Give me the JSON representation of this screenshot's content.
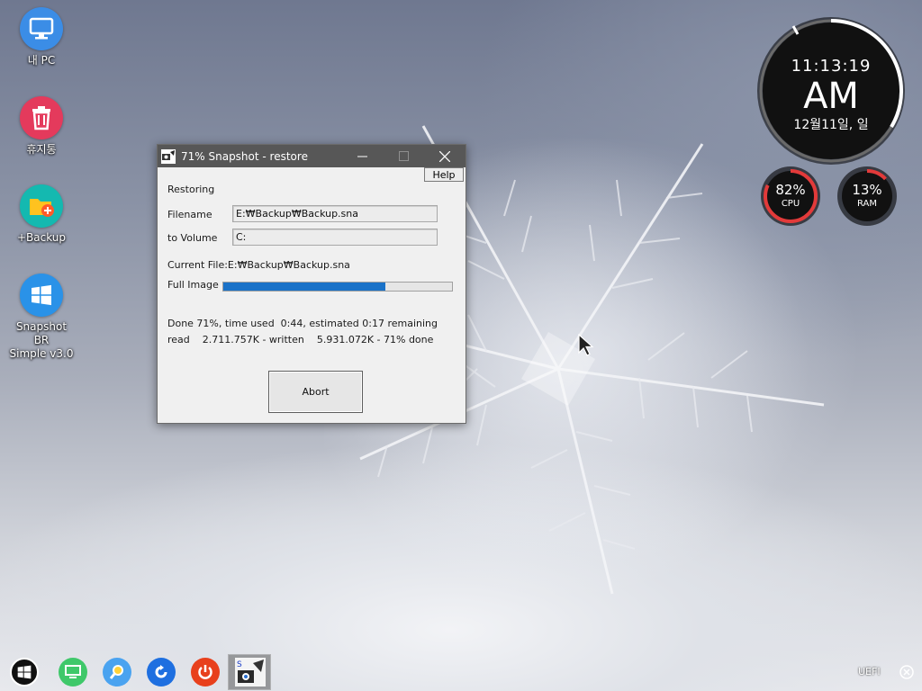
{
  "desktop": {
    "icons": [
      {
        "label": "내 PC",
        "icon": "monitor-icon",
        "color": "#3b8de6"
      },
      {
        "label": "휴지통",
        "icon": "trash-icon",
        "color": "#e43a5c"
      },
      {
        "label": "+Backup",
        "icon": "folder-plus-icon",
        "color": "#14b9b0"
      },
      {
        "label": "Snapshot BR\nSimple v3.0",
        "icon": "windows-logo-icon",
        "color": "#2a92e8"
      }
    ]
  },
  "clock": {
    "time": "11:13:19",
    "ampm": "AM",
    "date": "12월11일, 일"
  },
  "meters": {
    "cpu": {
      "value": "82%",
      "label": "CPU",
      "percent": 82,
      "color": "#e23a3a"
    },
    "ram": {
      "value": "13%",
      "label": "RAM",
      "percent": 13,
      "color": "#e23a3a"
    }
  },
  "dialog": {
    "title": "71% Snapshot - restore",
    "help_label": "Help",
    "status_label": "Restoring",
    "filename_label": "Filename",
    "filename_value": "E:₩Backup₩Backup.sna",
    "volume_label": "to Volume",
    "volume_value": "C:",
    "current_file": "Current File:E:₩Backup₩Backup.sna",
    "image_label": "Full Image",
    "progress_percent": 71,
    "line1": "Done 71%, time used  0:44, estimated 0:17 remaining",
    "line2": "read    2.711.757K - written    5.931.072K - 71% done",
    "abort_label": "Abort"
  },
  "taskbar": {
    "items": [
      "start-icon",
      "monitor-icon",
      "search-icon",
      "refresh-icon",
      "power-icon",
      "snapshot-app-icon"
    ],
    "tray_text": "UEFI"
  }
}
